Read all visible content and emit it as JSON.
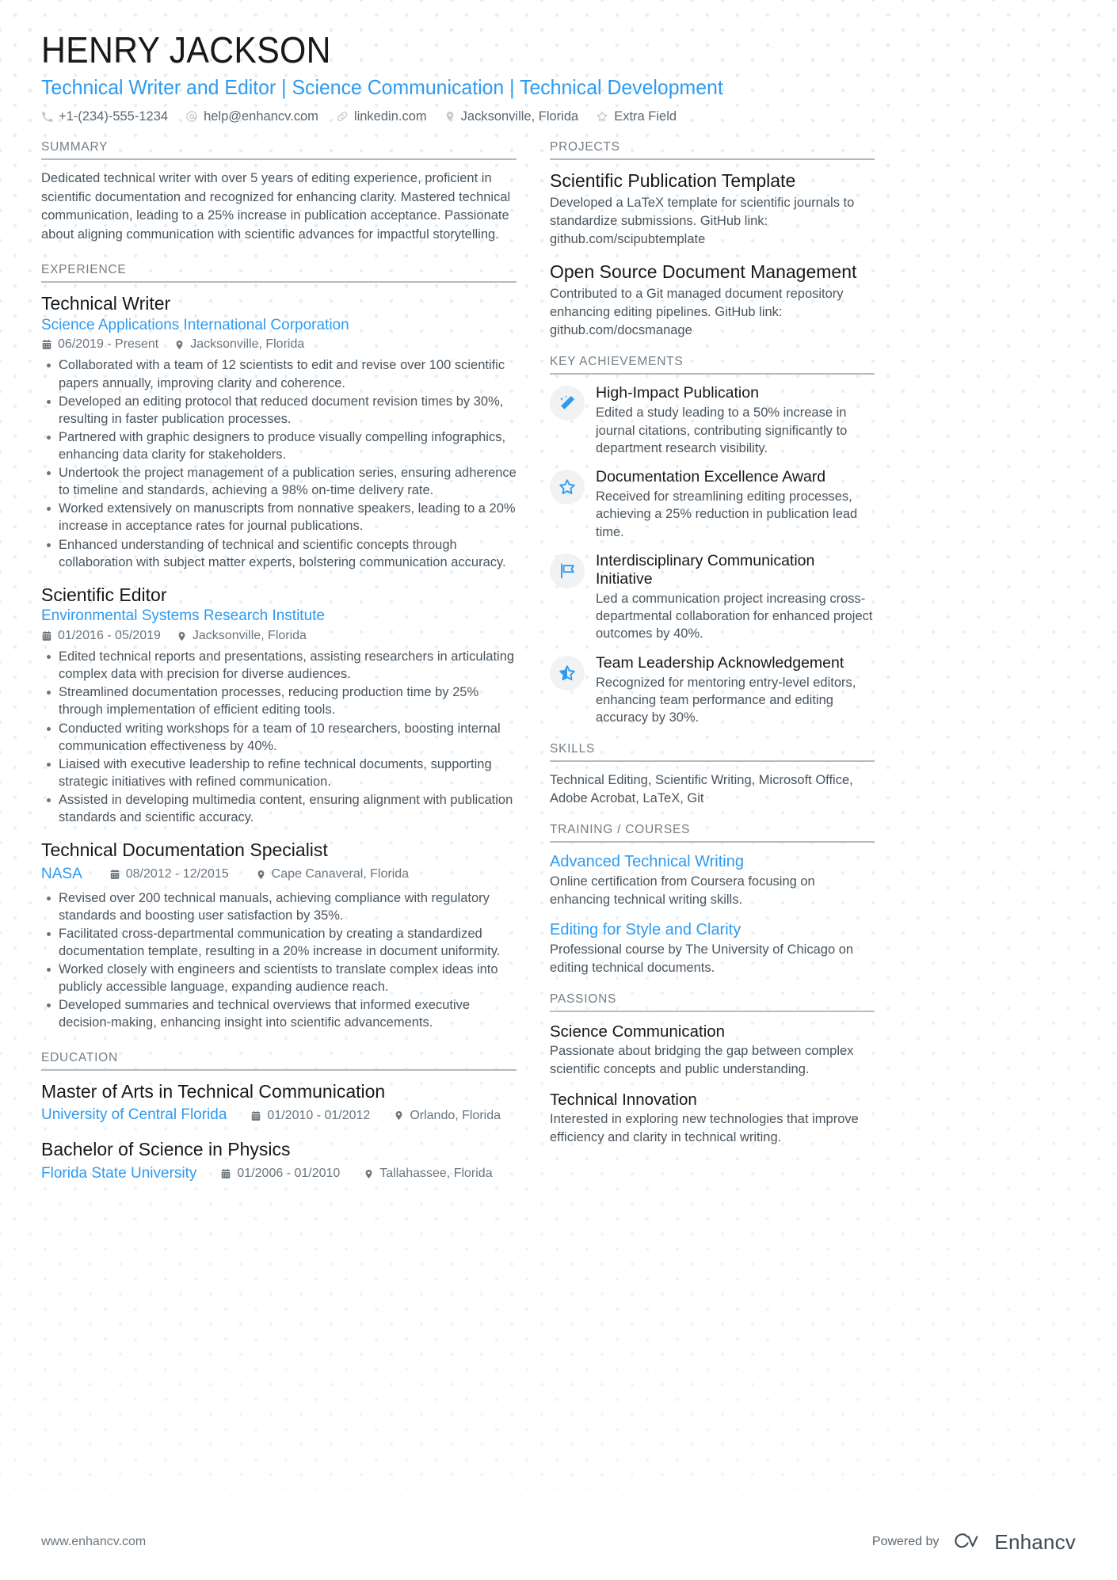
{
  "header": {
    "name": "HENRY JACKSON",
    "headline": "Technical Writer and Editor | Science Communication | Technical Development",
    "contacts": [
      {
        "icon": "phone-icon",
        "text": "+1-(234)-555-1234"
      },
      {
        "icon": "email-icon",
        "text": "help@enhancv.com"
      },
      {
        "icon": "link-icon",
        "text": "linkedin.com"
      },
      {
        "icon": "location-icon",
        "text": "Jacksonville, Florida"
      },
      {
        "icon": "star-icon",
        "text": "Extra Field"
      }
    ]
  },
  "left": {
    "summary": {
      "heading": "SUMMARY",
      "text": "Dedicated technical writer with over 5 years of editing experience, proficient in scientific documentation and recognized for enhancing clarity. Mastered technical communication, leading to a 25% increase in publication acceptance. Passionate about aligning communication with scientific advances for impactful storytelling."
    },
    "experience": {
      "heading": "EXPERIENCE",
      "entries": [
        {
          "title": "Technical Writer",
          "company": "Science Applications International Corporation",
          "dates": "06/2019 - Present",
          "location": "Jacksonville, Florida",
          "inline": false,
          "bullets": [
            "Collaborated with a team of 12 scientists to edit and revise over 100 scientific papers annually, improving clarity and coherence.",
            "Developed an editing protocol that reduced document revision times by 30%, resulting in faster publication processes.",
            "Partnered with graphic designers to produce visually compelling infographics, enhancing data clarity for stakeholders.",
            "Undertook the project management of a publication series, ensuring adherence to timeline and standards, achieving a 98% on-time delivery rate.",
            "Worked extensively on manuscripts from nonnative speakers, leading to a 20% increase in acceptance rates for journal publications.",
            "Enhanced understanding of technical and scientific concepts through collaboration with subject matter experts, bolstering communication accuracy."
          ]
        },
        {
          "title": "Scientific Editor",
          "company": "Environmental Systems Research Institute",
          "dates": "01/2016 - 05/2019",
          "location": "Jacksonville, Florida",
          "inline": false,
          "bullets": [
            "Edited technical reports and presentations, assisting researchers in articulating complex data with precision for diverse audiences.",
            "Streamlined documentation processes, reducing production time by 25% through implementation of efficient editing tools.",
            "Conducted writing workshops for a team of 10 researchers, boosting internal communication effectiveness by 40%.",
            "Liaised with executive leadership to refine technical documents, supporting strategic initiatives with refined communication.",
            "Assisted in developing multimedia content, ensuring alignment with publication standards and scientific accuracy."
          ]
        },
        {
          "title": "Technical Documentation Specialist",
          "company": "NASA",
          "dates": "08/2012 - 12/2015",
          "location": "Cape Canaveral, Florida",
          "inline": true,
          "bullets": [
            "Revised over 200 technical manuals, achieving compliance with regulatory standards and boosting user satisfaction by 35%.",
            "Facilitated cross-departmental communication by creating a standardized documentation template, resulting in a 20% increase in document uniformity.",
            "Worked closely with engineers and scientists to translate complex ideas into publicly accessible language, expanding audience reach.",
            "Developed summaries and technical overviews that informed executive decision-making, enhancing insight into scientific advancements."
          ]
        }
      ]
    },
    "education": {
      "heading": "EDUCATION",
      "entries": [
        {
          "title": "Master of Arts in Technical Communication",
          "school": "University of Central Florida",
          "dates": "01/2010 - 01/2012",
          "location": "Orlando, Florida"
        },
        {
          "title": "Bachelor of Science in Physics",
          "school": "Florida State University",
          "dates": "01/2006 - 01/2010",
          "location": "Tallahassee, Florida"
        }
      ]
    }
  },
  "right": {
    "projects": {
      "heading": "PROJECTS",
      "items": [
        {
          "title": "Scientific Publication Template",
          "desc": "Developed a LaTeX template for scientific journals to standardize submissions. GitHub link: github.com/scipubtemplate"
        },
        {
          "title": "Open Source Document Management",
          "desc": "Contributed to a Git managed document repository enhancing editing pipelines. GitHub link: github.com/docsmanage"
        }
      ]
    },
    "achievements": {
      "heading": "KEY ACHIEVEMENTS",
      "items": [
        {
          "icon": "magic-wand-icon",
          "title": "High-Impact Publication",
          "desc": "Edited a study leading to a 50% increase in journal citations, contributing significantly to department research visibility."
        },
        {
          "icon": "star-outline-icon",
          "title": "Documentation Excellence Award",
          "desc": "Received for streamlining editing processes, achieving a 25% reduction in publication lead time."
        },
        {
          "icon": "flag-icon",
          "title": "Interdisciplinary Communication Initiative",
          "desc": "Led a communication project increasing cross-departmental collaboration for enhanced project outcomes by 40%."
        },
        {
          "icon": "half-star-icon",
          "title": "Team Leadership Acknowledgement",
          "desc": "Recognized for mentoring entry-level editors, enhancing team performance and editing accuracy by 30%."
        }
      ]
    },
    "skills": {
      "heading": "SKILLS",
      "text": "Technical Editing, Scientific Writing, Microsoft Office, Adobe Acrobat, LaTeX, Git"
    },
    "training": {
      "heading": "TRAINING / COURSES",
      "items": [
        {
          "title": "Advanced Technical Writing",
          "desc": "Online certification from Coursera focusing on enhancing technical writing skills."
        },
        {
          "title": "Editing for Style and Clarity",
          "desc": "Professional course by The University of Chicago on editing technical documents."
        }
      ]
    },
    "passions": {
      "heading": "PASSIONS",
      "items": [
        {
          "title": "Science Communication",
          "desc": "Passionate about bridging the gap between complex scientific concepts and public understanding."
        },
        {
          "title": "Technical Innovation",
          "desc": "Interested in exploring new technologies that improve efficiency and clarity in technical writing."
        }
      ]
    }
  },
  "footer": {
    "url": "www.enhancv.com",
    "powered_by": "Powered by",
    "brand": "Enhancv"
  },
  "colors": {
    "accent": "#2e9bf0",
    "text": "#4a555e",
    "heading": "#16191c",
    "muted": "#747e86",
    "rule": "#b5bbc1"
  }
}
